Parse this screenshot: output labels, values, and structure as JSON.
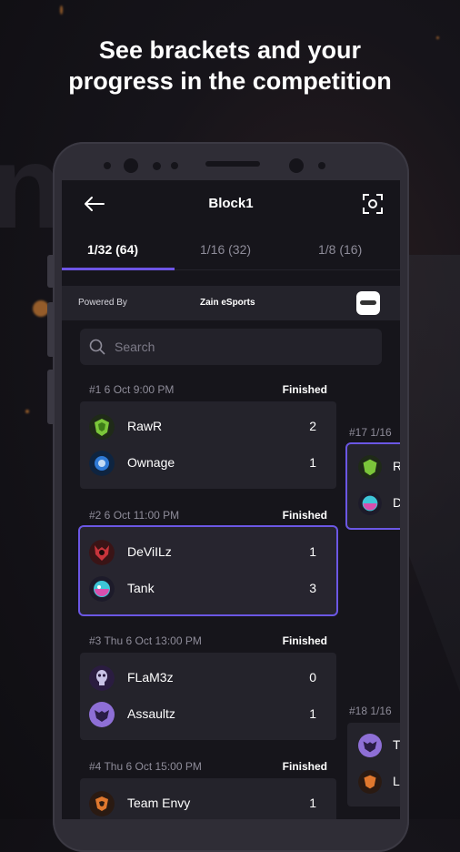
{
  "hero": {
    "line1": "See brackets and your",
    "line2": "progress in the competition"
  },
  "appbar": {
    "title": "Block1"
  },
  "tabs": [
    {
      "label": "1/32 (64)"
    },
    {
      "label": "1/16 (32)"
    },
    {
      "label": "1/8 (16)"
    }
  ],
  "powered": {
    "label": "Powered By",
    "org": "Zain eSports"
  },
  "search": {
    "placeholder": "Search"
  },
  "matches": [
    {
      "header": "#1  6 Oct 9:00 PM",
      "status": "Finished",
      "teams": [
        {
          "name": "RawR",
          "score": "2"
        },
        {
          "name": "Ownage",
          "score": "1"
        }
      ]
    },
    {
      "header": "#2  6 Oct 11:00 PM",
      "status": "Finished",
      "teams": [
        {
          "name": "DeViILz",
          "score": "1"
        },
        {
          "name": "Tank",
          "score": "3"
        }
      ]
    },
    {
      "header": "#3  Thu 6 Oct 13:00 PM",
      "status": "Finished",
      "teams": [
        {
          "name": "FLaM3z",
          "score": "0"
        },
        {
          "name": "Assaultz",
          "score": "1"
        }
      ]
    },
    {
      "header": "#4  Thu 6 Oct 15:00 PM",
      "status": "Finished",
      "teams": [
        {
          "name": "Team Envy",
          "score": "1"
        }
      ]
    }
  ],
  "next_round": [
    {
      "header": "#17  1/16",
      "rows": [
        "R",
        "D"
      ]
    },
    {
      "header": "#18  1/16",
      "rows": [
        "T",
        "L"
      ]
    }
  ],
  "colors": {
    "accent": "#6b57e4",
    "card": "#24232b",
    "screen": "#16151b"
  }
}
